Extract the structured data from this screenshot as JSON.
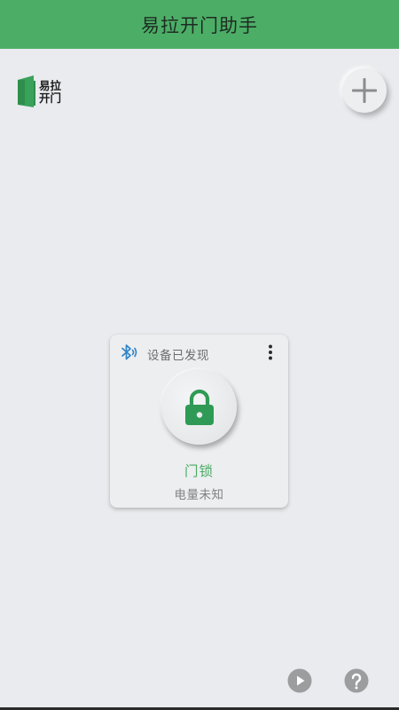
{
  "header": {
    "title": "易拉开门助手"
  },
  "logo": {
    "line1": "易拉",
    "line2": "开门"
  },
  "device_card": {
    "status": "设备已发现",
    "name": "门锁",
    "battery": "电量未知"
  },
  "icons": {
    "add": "plus-icon",
    "bluetooth": "bluetooth-icon",
    "more": "more-vertical-icon",
    "lock": "lock-icon",
    "play": "play-icon",
    "help": "help-icon"
  },
  "colors": {
    "header_bg": "#4cae66",
    "accent_green": "#4bab63",
    "lock_green": "#2f9a55",
    "bluetooth_blue": "#2f84c8",
    "background": "#e9ebee",
    "grey_icon": "#9c9d9f"
  }
}
